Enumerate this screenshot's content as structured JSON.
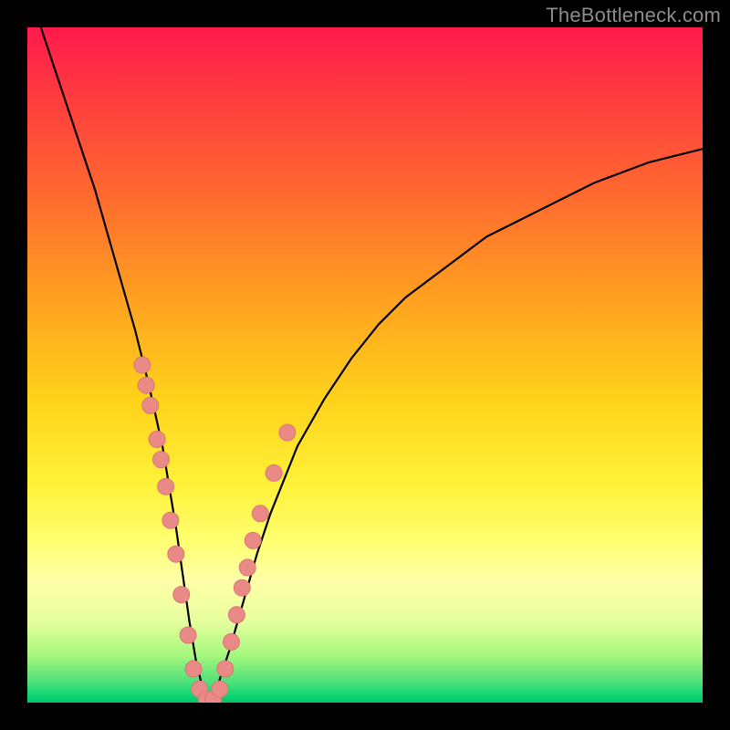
{
  "watermark": "TheBottleneck.com",
  "colors": {
    "curve_stroke": "#000000",
    "marker_fill": "#e98a86",
    "marker_stroke": "#d97773",
    "background_border": "#000000"
  },
  "chart_data": {
    "type": "line",
    "title": "",
    "xlabel": "",
    "ylabel": "",
    "xlim": [
      0,
      100
    ],
    "ylim": [
      0,
      100
    ],
    "series": [
      {
        "name": "bottleneck-curve",
        "x": [
          2,
          4,
          6,
          8,
          10,
          12,
          14,
          16,
          18,
          20,
          22,
          23,
          24,
          25,
          26,
          27,
          28,
          30,
          32,
          34,
          36,
          38,
          40,
          44,
          48,
          52,
          56,
          60,
          64,
          68,
          72,
          76,
          80,
          84,
          88,
          92,
          96,
          100
        ],
        "y": [
          100,
          94,
          88,
          82,
          76,
          69,
          62,
          55,
          47,
          38,
          26,
          19,
          12,
          6,
          2,
          0,
          2,
          8,
          15,
          22,
          28,
          33,
          38,
          45,
          51,
          56,
          60,
          63,
          66,
          69,
          71,
          73,
          75,
          77,
          78.5,
          80,
          81,
          82
        ]
      }
    ],
    "annotations": {
      "markers_on_curve": [
        {
          "x": 17.0,
          "y": 50
        },
        {
          "x": 17.6,
          "y": 47
        },
        {
          "x": 18.2,
          "y": 44
        },
        {
          "x": 19.2,
          "y": 39
        },
        {
          "x": 19.8,
          "y": 36
        },
        {
          "x": 20.5,
          "y": 32
        },
        {
          "x": 21.2,
          "y": 27
        },
        {
          "x": 22.0,
          "y": 22
        },
        {
          "x": 22.8,
          "y": 16
        },
        {
          "x": 23.8,
          "y": 10
        },
        {
          "x": 24.6,
          "y": 5
        },
        {
          "x": 25.5,
          "y": 2
        },
        {
          "x": 26.5,
          "y": 0.5
        },
        {
          "x": 27.5,
          "y": 0.5
        },
        {
          "x": 28.5,
          "y": 2
        },
        {
          "x": 29.3,
          "y": 5
        },
        {
          "x": 30.2,
          "y": 9
        },
        {
          "x": 31.0,
          "y": 13
        },
        {
          "x": 31.8,
          "y": 17
        },
        {
          "x": 32.6,
          "y": 20
        },
        {
          "x": 33.4,
          "y": 24
        },
        {
          "x": 34.5,
          "y": 28
        },
        {
          "x": 36.5,
          "y": 34
        },
        {
          "x": 38.5,
          "y": 40
        }
      ],
      "marker_radius_px": 9
    }
  }
}
